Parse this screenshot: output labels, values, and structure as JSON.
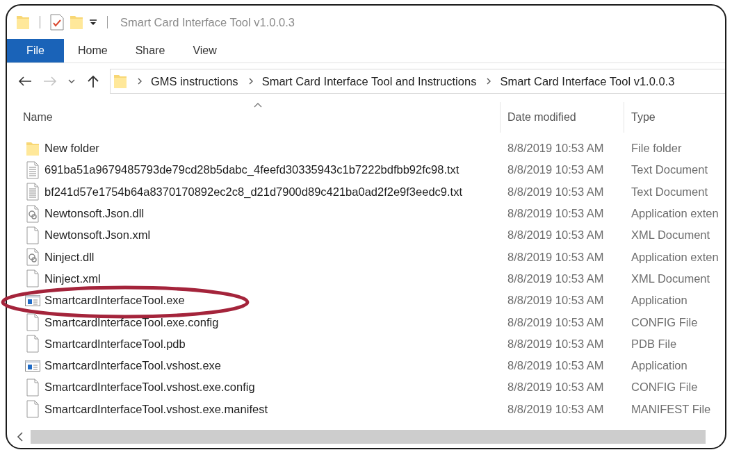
{
  "window": {
    "title": "Smart Card Interface Tool v1.0.0.3"
  },
  "tabs": [
    {
      "label": "File",
      "selected": true
    },
    {
      "label": "Home",
      "selected": false
    },
    {
      "label": "Share",
      "selected": false
    },
    {
      "label": "View",
      "selected": false
    }
  ],
  "address": {
    "crumbs": [
      "GMS instructions",
      "Smart Card Interface Tool and Instructions",
      "Smart Card Interface Tool v1.0.0.3"
    ]
  },
  "columns": [
    {
      "label": "Name",
      "sorted": true
    },
    {
      "label": "Date modified",
      "sorted": false
    },
    {
      "label": "Type",
      "sorted": false
    }
  ],
  "rows": [
    {
      "name": "New folder",
      "date": "8/8/2019 10:53 AM",
      "type": "File folder",
      "kind": "folder",
      "circled": false
    },
    {
      "name": "691ba51a9679485793de79cd28b5dabc_4feefd30335943c1b7222bdfbb92fc98.txt",
      "date": "8/8/2019 10:53 AM",
      "type": "Text Document",
      "kind": "text",
      "circled": false
    },
    {
      "name": "bf241d57e1754b64a8370170892ec2c8_d21d7900d89c421ba0ad2f2e9f3eedc9.txt",
      "date": "8/8/2019 10:53 AM",
      "type": "Text Document",
      "kind": "text",
      "circled": false
    },
    {
      "name": "Newtonsoft.Json.dll",
      "date": "8/8/2019 10:53 AM",
      "type": "Application exten",
      "kind": "library",
      "circled": false
    },
    {
      "name": "Newtonsoft.Json.xml",
      "date": "8/8/2019 10:53 AM",
      "type": "XML Document",
      "kind": "blank",
      "circled": false
    },
    {
      "name": "Ninject.dll",
      "date": "8/8/2019 10:53 AM",
      "type": "Application exten",
      "kind": "library",
      "circled": false
    },
    {
      "name": "Ninject.xml",
      "date": "8/8/2019 10:53 AM",
      "type": "XML Document",
      "kind": "blank",
      "circled": false
    },
    {
      "name": "SmartcardInterfaceTool.exe",
      "date": "8/8/2019 10:53 AM",
      "type": "Application",
      "kind": "program",
      "circled": true
    },
    {
      "name": "SmartcardInterfaceTool.exe.config",
      "date": "8/8/2019 10:53 AM",
      "type": "CONFIG File",
      "kind": "blank",
      "circled": false
    },
    {
      "name": "SmartcardInterfaceTool.pdb",
      "date": "8/8/2019 10:53 AM",
      "type": "PDB File",
      "kind": "blank",
      "circled": false
    },
    {
      "name": "SmartcardInterfaceTool.vshost.exe",
      "date": "8/8/2019 10:53 AM",
      "type": "Application",
      "kind": "program",
      "circled": false
    },
    {
      "name": "SmartcardInterfaceTool.vshost.exe.config",
      "date": "8/8/2019 10:53 AM",
      "type": "CONFIG File",
      "kind": "blank",
      "circled": false
    },
    {
      "name": "SmartcardInterfaceTool.vshost.exe.manifest",
      "date": "8/8/2019 10:53 AM",
      "type": "MANIFEST File",
      "kind": "blank",
      "circled": false
    }
  ]
}
